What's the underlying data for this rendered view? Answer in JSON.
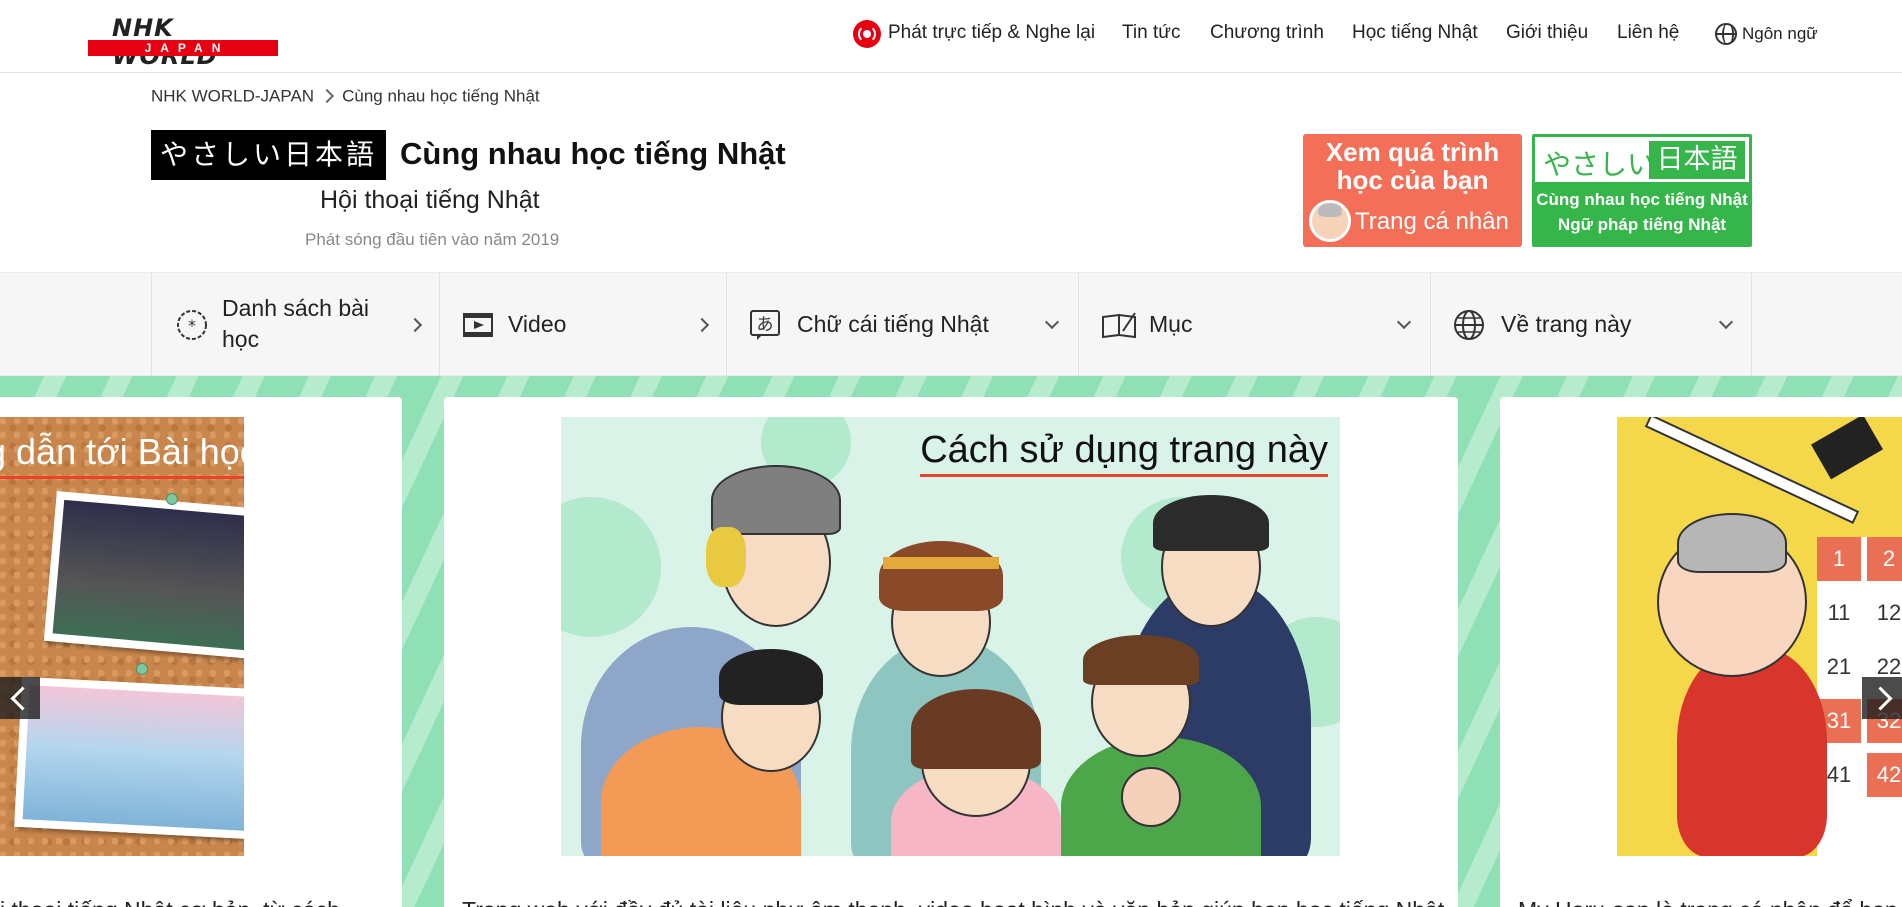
{
  "header": {
    "logo_text": "NHK WORLD",
    "logo_sub": "JAPAN",
    "nav": [
      {
        "label": "Phát trực tiếp & Nghe lại",
        "icon": "live-icon"
      },
      {
        "label": "Tin tức"
      },
      {
        "label": "Chương trình"
      },
      {
        "label": "Học tiếng Nhật"
      },
      {
        "label": "Giới thiệu"
      },
      {
        "label": "Liên hệ"
      },
      {
        "label": "Ngôn ngữ",
        "icon": "globe-icon"
      }
    ],
    "brand_color": "#e60012"
  },
  "breadcrumb": {
    "root": "NHK WORLD-JAPAN",
    "current": "Cùng nhau học tiếng Nhật"
  },
  "program": {
    "badge": "やさしい日本語",
    "title": "Cùng nhau học tiếng Nhật",
    "subtitle": "Hội thoại tiếng Nhật",
    "note": "Phát sóng đầu tiên vào năm 2019"
  },
  "promos": {
    "orange": {
      "line1": "Xem quá trình",
      "line2": "học của bạn",
      "link": "Trang cá nhân",
      "color": "#f36f58"
    },
    "green": {
      "kana": "やさしい",
      "kanji": "日本語",
      "line1": "Cùng nhau học tiếng Nhật",
      "line2": "Ngữ pháp tiếng Nhật",
      "color": "#35b54a"
    }
  },
  "menu": [
    {
      "label": "Danh sách bài học",
      "icon": "lesson-list-icon",
      "indicator": "chevron-right"
    },
    {
      "label": "Video",
      "icon": "video-icon",
      "indicator": "chevron-right"
    },
    {
      "label": "Chữ cái tiếng Nhật",
      "icon": "hiragana-icon",
      "indicator": "chevron-down"
    },
    {
      "label": "Mục",
      "icon": "book-icon",
      "indicator": "chevron-down"
    },
    {
      "label": "Về trang này",
      "icon": "globe-icon",
      "indicator": "chevron-down"
    }
  ],
  "carousel": {
    "background": "#8fe0b4",
    "slides": [
      {
        "image_title": "g dẫn tới Bài học",
        "caption": "i thoại tiếng Nhật cơ bản, từ cách"
      },
      {
        "image_title": "Cách sử dụng trang này",
        "caption": "Trang web với đầy đủ tài liệu như âm thanh, video hoạt hình và văn bản giúp bạn học tiếng Nhật"
      },
      {
        "image_title": "",
        "caption": "My Haru-san là trang cá nhân để bạn t"
      }
    ],
    "calendar_numbers": [
      "1",
      "2",
      "11",
      "12",
      "21",
      "22",
      "31",
      "32",
      "41",
      "42"
    ]
  }
}
